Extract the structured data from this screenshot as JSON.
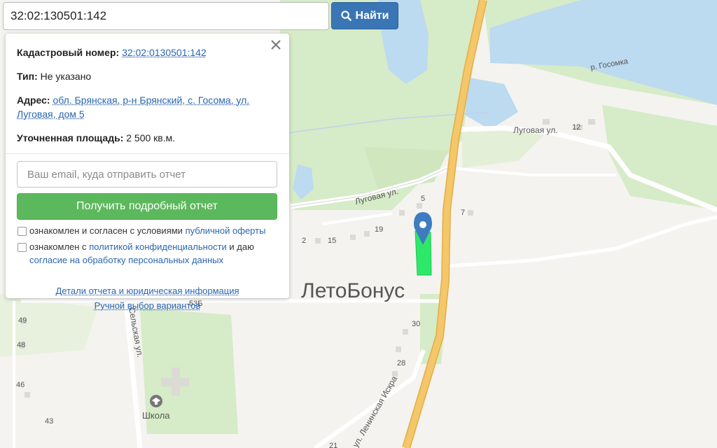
{
  "search": {
    "value": "32:02:130501:142",
    "button_label": "Найти"
  },
  "panel": {
    "cadastral_label": "Кадастровый номер:",
    "cadastral_value": "32:02:0130501:142",
    "type_label": "Тип:",
    "type_value": "Не указано",
    "address_label": "Адрес:",
    "address_line1": "обл. Брянская, р-н Брянский, с. Госома, ул.",
    "address_line2": "Луговая, дом 5",
    "area_label": "Уточненная площадь:",
    "area_value": "2 500 кв.м.",
    "email_placeholder": "Ваш email, куда отправить отчет",
    "report_button": "Получить подробный отчет",
    "consent1_text": "ознакомлен и согласен с условиями",
    "consent1_link": "публичной оферты",
    "consent2_text": "ознакомлен с",
    "consent2_link": "политикой конфиденциальности",
    "consent2_tail": "и даю",
    "consent2_link2": "согласие на обработку персональных данных",
    "details_link": "Детали отчета и юридическая информация",
    "manual_link": "Ручной выбор вариантов"
  },
  "map": {
    "colors": {
      "water": "#bcdaf0",
      "forest": "#d6ebc7",
      "road": "#f3c76a",
      "parcel": "#2ee86a",
      "marker": "#3e7cc0"
    },
    "labels": {
      "river": "р. Госомка",
      "street_lugovaya_1": "Луговая ул.",
      "street_lugovaya_2": "Луговая ул.",
      "street_selskaya": "Сельская ул.",
      "street_leninskaya": "ул. Ленинская Искра",
      "school": "Школа",
      "watermark": "ЛетоБонус"
    },
    "house_numbers": {
      "h12": "12",
      "h5": "5",
      "h7": "7",
      "h19": "19",
      "h15": "15",
      "h2": "2",
      "h53b": "53Б",
      "h49": "49",
      "h48": "48",
      "h46": "46",
      "h43": "43",
      "h30": "30",
      "h28": "28",
      "h21": "21"
    }
  }
}
